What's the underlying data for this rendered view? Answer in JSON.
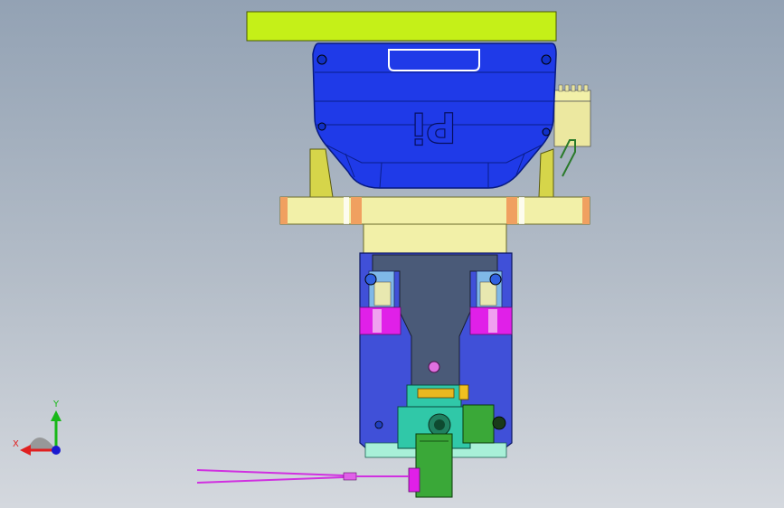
{
  "axes": {
    "x_label": "X",
    "y_label": "Y",
    "x_color": "#e02020",
    "y_color": "#18b818",
    "z_color": "#1a1ad0"
  },
  "model": {
    "top_plate_color": "#c5f018",
    "housing_color": "#1f3ae8",
    "housing_emblem": "Pi",
    "flange_color": "#f2f0a8",
    "accent_orange": "#f0a060",
    "gripper_body_color": "#4050d8",
    "gripper_core_color": "#4a5a78",
    "magenta_color": "#e020e8",
    "teal_color": "#30c8a8",
    "green_color": "#3aa838",
    "pink_dot_color": "#e070e0"
  }
}
